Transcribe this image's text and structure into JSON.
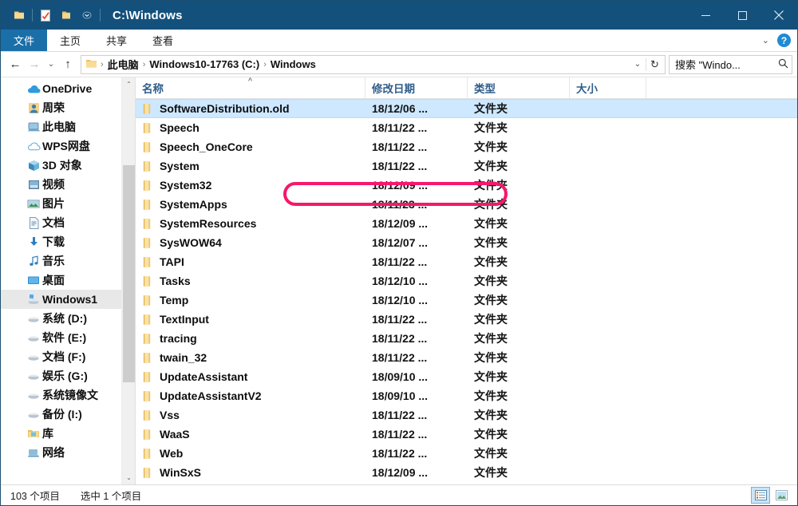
{
  "window": {
    "title": "C:\\Windows",
    "quick_access": [
      {
        "name": "folder-pin-icon",
        "label": "固定到快速访问"
      },
      {
        "name": "properties-icon",
        "label": "属性"
      },
      {
        "name": "new-folder-icon",
        "label": "新建文件夹"
      },
      {
        "name": "chevron-down-icon",
        "label": "自定义快速访问工具栏"
      }
    ],
    "controls": {
      "minimize": "—",
      "maximize": "□",
      "close": "✕"
    }
  },
  "ribbon": {
    "tabs": [
      {
        "label": "文件",
        "active": true
      },
      {
        "label": "主页",
        "active": false
      },
      {
        "label": "共享",
        "active": false
      },
      {
        "label": "查看",
        "active": false
      }
    ],
    "expand_label": "⌄",
    "help_label": "?"
  },
  "address": {
    "back": "←",
    "forward": "→",
    "recent": "⌄",
    "up": "↑",
    "breadcrumbs": [
      "此电脑",
      "Windows10-17763 (C:)",
      "Windows"
    ],
    "separator": "›",
    "dropdown": "⌄",
    "refresh": "↻"
  },
  "search": {
    "value": "搜索 \"Windo...",
    "placeholder": "搜索 \"Windows\"",
    "icon": "⚲"
  },
  "sidebar": {
    "scroll_up": "⌃",
    "scroll_down": "⌄",
    "items": [
      {
        "label": "OneDrive",
        "icon": "cloud-icon",
        "indent": 0,
        "selected": false
      },
      {
        "label": "周荣",
        "icon": "user-icon",
        "indent": 0,
        "selected": false
      },
      {
        "label": "此电脑",
        "icon": "computer-icon",
        "indent": 0,
        "selected": false
      },
      {
        "label": "WPS网盘",
        "icon": "cloud-outline-icon",
        "indent": 1,
        "selected": false
      },
      {
        "label": "3D 对象",
        "icon": "cube-icon",
        "indent": 1,
        "selected": false
      },
      {
        "label": "视频",
        "icon": "video-icon",
        "indent": 1,
        "selected": false
      },
      {
        "label": "图片",
        "icon": "picture-icon",
        "indent": 1,
        "selected": false
      },
      {
        "label": "文档",
        "icon": "document-icon",
        "indent": 1,
        "selected": false
      },
      {
        "label": "下载",
        "icon": "download-icon",
        "indent": 1,
        "selected": false
      },
      {
        "label": "音乐",
        "icon": "music-icon",
        "indent": 1,
        "selected": false
      },
      {
        "label": "桌面",
        "icon": "desktop-icon",
        "indent": 1,
        "selected": false
      },
      {
        "label": "Windows1",
        "icon": "drive-windows-icon",
        "indent": 1,
        "selected": true
      },
      {
        "label": "系统 (D:)",
        "icon": "drive-icon",
        "indent": 1,
        "selected": false
      },
      {
        "label": "软件 (E:)",
        "icon": "drive-icon",
        "indent": 1,
        "selected": false
      },
      {
        "label": "文档 (F:)",
        "icon": "drive-icon",
        "indent": 1,
        "selected": false
      },
      {
        "label": "娱乐 (G:)",
        "icon": "drive-icon",
        "indent": 1,
        "selected": false
      },
      {
        "label": "系统镜像文",
        "icon": "drive-icon",
        "indent": 1,
        "selected": false
      },
      {
        "label": "备份 (I:)",
        "icon": "drive-icon",
        "indent": 1,
        "selected": false
      },
      {
        "label": "库",
        "icon": "library-icon",
        "indent": 0,
        "selected": false
      },
      {
        "label": "网络",
        "icon": "network-icon",
        "indent": 0,
        "selected": false
      }
    ]
  },
  "filelist": {
    "columns": [
      {
        "label": "名称",
        "sort": "asc"
      },
      {
        "label": "修改日期",
        "sort": null
      },
      {
        "label": "类型",
        "sort": null
      },
      {
        "label": "大小",
        "sort": null
      }
    ],
    "rows": [
      {
        "name": "SoftwareDistribution.old",
        "date": "18/12/06 ...",
        "type": "文件夹",
        "size": "",
        "selected": true,
        "annotated": true
      },
      {
        "name": "Speech",
        "date": "18/11/22 ...",
        "type": "文件夹",
        "size": "",
        "selected": false,
        "annotated": false
      },
      {
        "name": "Speech_OneCore",
        "date": "18/11/22 ...",
        "type": "文件夹",
        "size": "",
        "selected": false,
        "annotated": false
      },
      {
        "name": "System",
        "date": "18/11/22 ...",
        "type": "文件夹",
        "size": "",
        "selected": false,
        "annotated": false
      },
      {
        "name": "System32",
        "date": "18/12/09 ...",
        "type": "文件夹",
        "size": "",
        "selected": false,
        "annotated": false
      },
      {
        "name": "SystemApps",
        "date": "18/11/23 ...",
        "type": "文件夹",
        "size": "",
        "selected": false,
        "annotated": false
      },
      {
        "name": "SystemResources",
        "date": "18/12/09 ...",
        "type": "文件夹",
        "size": "",
        "selected": false,
        "annotated": false
      },
      {
        "name": "SysWOW64",
        "date": "18/12/07 ...",
        "type": "文件夹",
        "size": "",
        "selected": false,
        "annotated": false
      },
      {
        "name": "TAPI",
        "date": "18/11/22 ...",
        "type": "文件夹",
        "size": "",
        "selected": false,
        "annotated": false
      },
      {
        "name": "Tasks",
        "date": "18/12/10 ...",
        "type": "文件夹",
        "size": "",
        "selected": false,
        "annotated": false
      },
      {
        "name": "Temp",
        "date": "18/12/10 ...",
        "type": "文件夹",
        "size": "",
        "selected": false,
        "annotated": false
      },
      {
        "name": "TextInput",
        "date": "18/11/22 ...",
        "type": "文件夹",
        "size": "",
        "selected": false,
        "annotated": false
      },
      {
        "name": "tracing",
        "date": "18/11/22 ...",
        "type": "文件夹",
        "size": "",
        "selected": false,
        "annotated": false
      },
      {
        "name": "twain_32",
        "date": "18/11/22 ...",
        "type": "文件夹",
        "size": "",
        "selected": false,
        "annotated": false
      },
      {
        "name": "UpdateAssistant",
        "date": "18/09/10 ...",
        "type": "文件夹",
        "size": "",
        "selected": false,
        "annotated": false
      },
      {
        "name": "UpdateAssistantV2",
        "date": "18/09/10 ...",
        "type": "文件夹",
        "size": "",
        "selected": false,
        "annotated": false
      },
      {
        "name": "Vss",
        "date": "18/11/22 ...",
        "type": "文件夹",
        "size": "",
        "selected": false,
        "annotated": false
      },
      {
        "name": "WaaS",
        "date": "18/11/22 ...",
        "type": "文件夹",
        "size": "",
        "selected": false,
        "annotated": false
      },
      {
        "name": "Web",
        "date": "18/11/22 ...",
        "type": "文件夹",
        "size": "",
        "selected": false,
        "annotated": false
      },
      {
        "name": "WinSxS",
        "date": "18/12/09 ...",
        "type": "文件夹",
        "size": "",
        "selected": false,
        "annotated": false
      }
    ]
  },
  "statusbar": {
    "item_count": "103 个项目",
    "selection": "选中 1 个项目",
    "views": [
      {
        "name": "details-view-button",
        "active": true
      },
      {
        "name": "large-icons-view-button",
        "active": false
      }
    ]
  },
  "colors": {
    "titlebar": "#13517c",
    "accent_tab": "#1b6fa8",
    "selection": "#cde8ff",
    "annotation": "#f5186b",
    "column_header_text": "#2f5d8a",
    "folder": "#f2c66a"
  }
}
